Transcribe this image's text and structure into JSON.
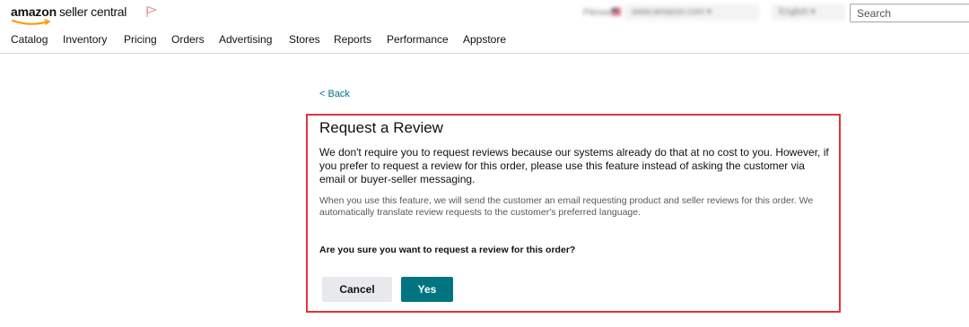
{
  "header": {
    "logo": {
      "brand": "amazon",
      "product": "seller central"
    },
    "marketplace": {
      "account_name": "Pikmee",
      "domain": "www.amazon.com",
      "language": "English"
    },
    "search": {
      "placeholder": "Search"
    },
    "nav": [
      {
        "label": "Catalog"
      },
      {
        "label": "Inventory"
      },
      {
        "label": "Pricing"
      },
      {
        "label": "Orders"
      },
      {
        "label": "Advertising"
      },
      {
        "label": "Stores"
      },
      {
        "label": "Reports"
      },
      {
        "label": "Performance"
      },
      {
        "label": "Appstore"
      }
    ]
  },
  "back_link": "< Back",
  "review_panel": {
    "title": "Request a Review",
    "intro": "We don't require you to request reviews because our systems already do that at no cost to you. However, if you prefer to request a review for this order, please use this feature instead of asking the customer via email or buyer-seller messaging.",
    "note": "When you use this feature, we will send the customer an email requesting product and seller reviews for this order. We automatically translate review requests to the customer's preferred language.",
    "question": "Are you sure you want to request a review for this order?",
    "cancel_label": "Cancel",
    "yes_label": "Yes"
  },
  "colors": {
    "highlight_border": "#e1343d",
    "primary_button": "#00757f",
    "link": "#007185",
    "logo_smile": "#ff9900",
    "flag_icon": "#e8a3a6"
  },
  "icons": [
    "amazon-smile-icon",
    "flag-icon",
    "us-flag-icon",
    "chevron-down-icon"
  ]
}
